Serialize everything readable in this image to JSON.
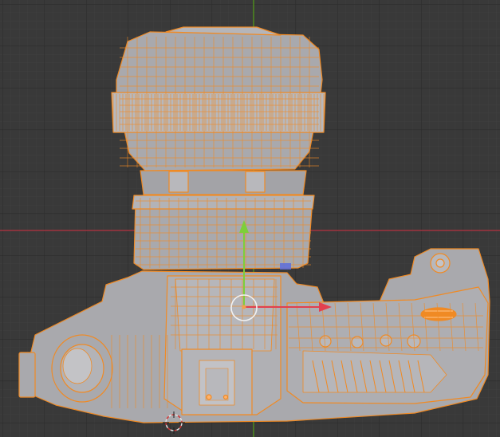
{
  "viewport": {
    "background": "#393939",
    "grid_minor_color": "#3f3f3f",
    "grid_major_color": "#2c2c2c",
    "x_axis_color": "#a1323f",
    "y_axis_color": "#4e8a1d",
    "selection_color": "#f08a24",
    "mesh_fill": "#a9a9ad"
  },
  "gizmo": {
    "y_arrow_color": "#7dcf3a",
    "x_arrow_color": "#e2404f",
    "z_handle_color": "#5b6fe0",
    "center_dot_color": "#f2a14a"
  },
  "cursor_3d": {
    "ring_colors": [
      "#e0e0e0",
      "#d23a3a"
    ]
  }
}
